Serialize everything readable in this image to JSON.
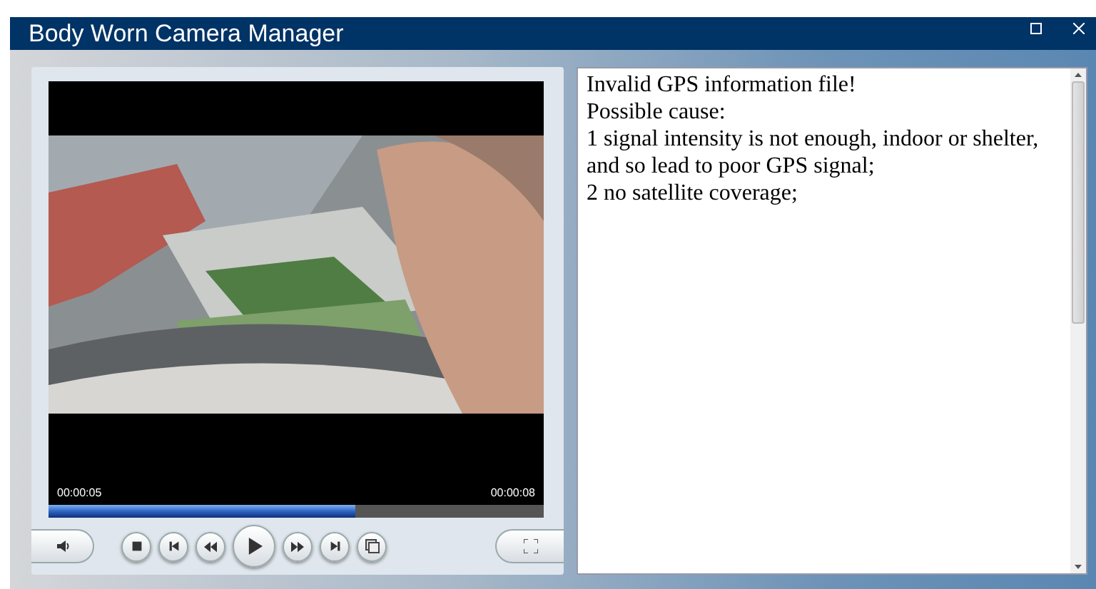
{
  "window": {
    "title": "Body Worn Camera Manager"
  },
  "player": {
    "time_elapsed": "00:00:05",
    "time_total": "00:00:08",
    "progress": {
      "level": 0.62
    }
  },
  "message": {
    "lines": [
      "Invalid GPS information file!",
      "Possible cause:",
      "1 signal intensity is not enough, indoor or shelter, and so lead to poor GPS signal;",
      "2 no satellite coverage;"
    ]
  }
}
